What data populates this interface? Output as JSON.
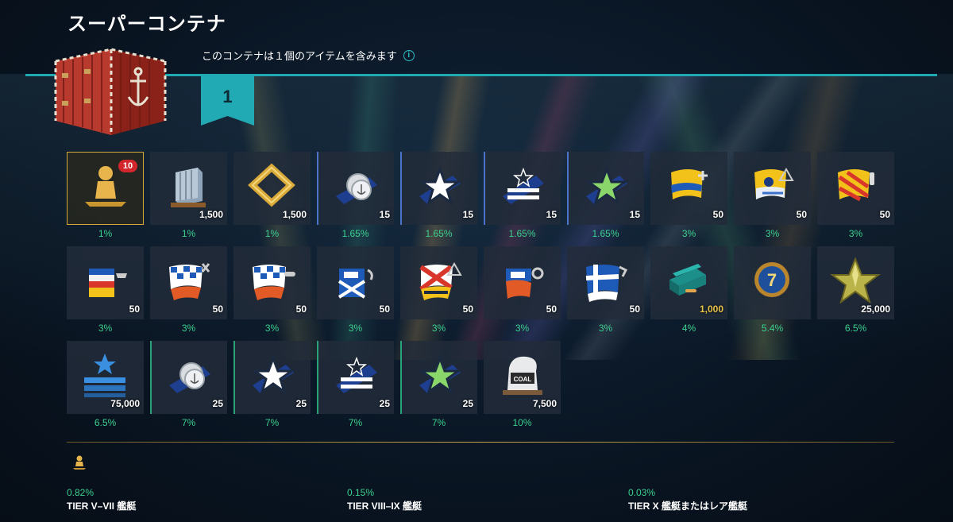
{
  "title": "スーパーコンテナ",
  "subtitle": "このコンテナは１個のアイテムを含みます",
  "ribbon_number": "1",
  "rows": [
    [
      {
        "icon": "ship-silhouette-icon",
        "qty": "",
        "pct": "1%",
        "badge": "10",
        "style": "hl"
      },
      {
        "icon": "port-slot-icon",
        "qty": "1,500",
        "pct": "1%",
        "style": ""
      },
      {
        "icon": "gold-frame-icon",
        "qty": "1,500",
        "pct": "1%",
        "style": ""
      },
      {
        "icon": "silver-coins-camo-icon",
        "qty": "15",
        "pct": "1.65%",
        "style": "blue"
      },
      {
        "icon": "star-camo-icon",
        "qty": "15",
        "pct": "1.65%",
        "style": "blue"
      },
      {
        "icon": "captain-xp-camo-icon",
        "qty": "15",
        "pct": "1.65%",
        "style": "blue"
      },
      {
        "icon": "green-star-camo-icon",
        "qty": "15",
        "pct": "1.65%",
        "style": "blue"
      },
      {
        "icon": "signal-flag-plus-icon",
        "qty": "50",
        "pct": "3%",
        "style": ""
      },
      {
        "icon": "signal-flag-triangle-icon",
        "qty": "50",
        "pct": "3%",
        "style": ""
      },
      {
        "icon": "signal-flag-extinguisher-icon",
        "qty": "50",
        "pct": "3%",
        "style": ""
      }
    ],
    [
      {
        "icon": "signal-flag-ship-icon",
        "qty": "50",
        "pct": "3%",
        "style": ""
      },
      {
        "icon": "signal-flag-checker-icon",
        "qty": "50",
        "pct": "3%",
        "style": ""
      },
      {
        "icon": "signal-flag-torpedo-icon",
        "qty": "50",
        "pct": "3%",
        "style": ""
      },
      {
        "icon": "signal-flag-cross-icon",
        "qty": "50",
        "pct": "3%",
        "style": ""
      },
      {
        "icon": "signal-flag-diagonal-icon",
        "qty": "50",
        "pct": "3%",
        "style": ""
      },
      {
        "icon": "signal-flag-armor-icon",
        "qty": "50",
        "pct": "3%",
        "style": ""
      },
      {
        "icon": "signal-flag-scandinavian-icon",
        "qty": "50",
        "pct": "3%",
        "style": ""
      },
      {
        "icon": "credits-box-icon",
        "qty": "1,000",
        "pct": "4%",
        "style": "",
        "gold": true
      },
      {
        "icon": "tier-7-medal-icon",
        "qty": "",
        "pct": "5.4%",
        "style": ""
      },
      {
        "icon": "gold-star-icon",
        "qty": "25,000",
        "pct": "6.5%",
        "style": ""
      }
    ],
    [
      {
        "icon": "commander-xp-icon",
        "qty": "75,000",
        "pct": "6.5%",
        "style": ""
      },
      {
        "icon": "silver-coins-camo-icon",
        "qty": "25",
        "pct": "7%",
        "style": "green"
      },
      {
        "icon": "star-camo-icon",
        "qty": "25",
        "pct": "7%",
        "style": "green"
      },
      {
        "icon": "captain-xp-camo-icon",
        "qty": "25",
        "pct": "7%",
        "style": "green"
      },
      {
        "icon": "green-star-camo-icon",
        "qty": "25",
        "pct": "7%",
        "style": "green"
      },
      {
        "icon": "coal-sack-icon",
        "qty": "7,500",
        "pct": "10%",
        "style": ""
      }
    ]
  ],
  "footer": [
    {
      "pct": "0.82%",
      "label": "TIER V–VII 艦艇"
    },
    {
      "pct": "0.15%",
      "label": "TIER VIII–IX 艦艇"
    },
    {
      "pct": "0.03%",
      "label": "TIER X 艦艇またはレア艦艇"
    }
  ]
}
